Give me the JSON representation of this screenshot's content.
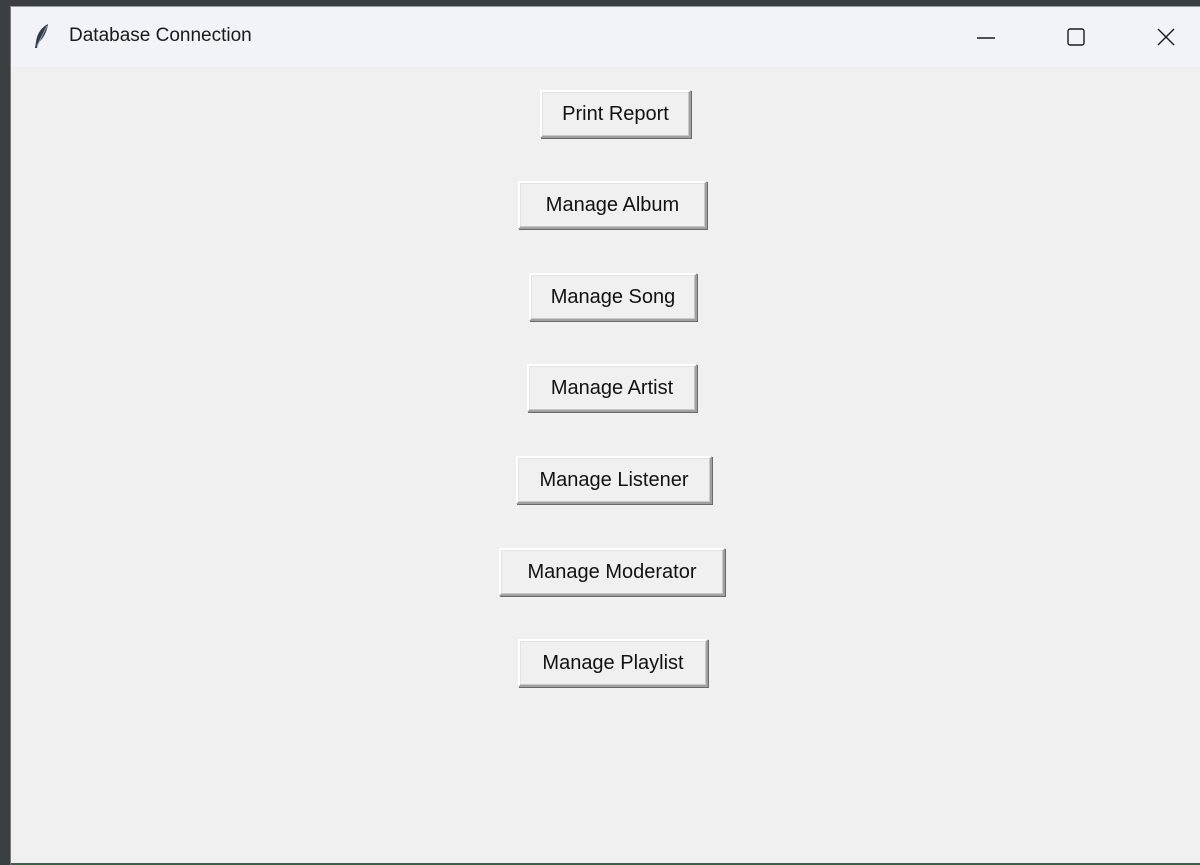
{
  "window": {
    "title": "Database Connection",
    "icon": "feather-icon"
  },
  "title_controls": {
    "minimize_icon": "minimize-icon",
    "maximize_icon": "maximize-icon",
    "close_icon": "close-icon"
  },
  "buttons": [
    {
      "label": "Print Report"
    },
    {
      "label": "Manage Album"
    },
    {
      "label": "Manage Song"
    },
    {
      "label": "Manage Artist"
    },
    {
      "label": "Manage Listener"
    },
    {
      "label": "Manage Moderator"
    },
    {
      "label": "Manage Playlist"
    }
  ],
  "colors": {
    "window_bg": "#f0f0f0",
    "titlebar_bg": "#f1f3f9",
    "text": "#111111"
  }
}
